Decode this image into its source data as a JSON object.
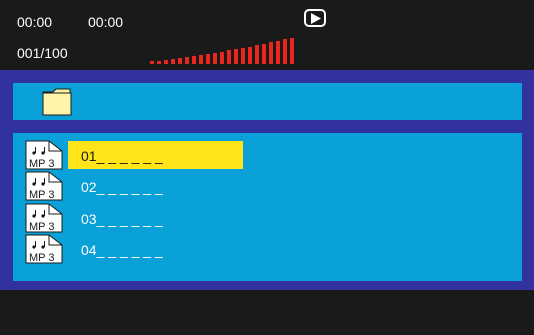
{
  "status": {
    "elapsed_time": "00:00",
    "total_time": "00:00",
    "track_counter": "001/100",
    "play_state_icon": "play-icon"
  },
  "level_meter": {
    "level": 1.0,
    "colors": {
      "bar": "#e8281e"
    }
  },
  "folder": {
    "icon": "folder-icon"
  },
  "file_list": {
    "items": [
      {
        "label": "01_ _ _ _ _ _",
        "icon": "mp3-file-icon",
        "icon_text": "MP 3",
        "selected": true
      },
      {
        "label": "02_ _ _ _ _ _",
        "icon": "mp3-file-icon",
        "icon_text": "MP 3",
        "selected": false
      },
      {
        "label": "03_ _ _ _ _ _",
        "icon": "mp3-file-icon",
        "icon_text": "MP 3",
        "selected": false
      },
      {
        "label": "04_ _ _ _ _ _",
        "icon": "mp3-file-icon",
        "icon_text": "MP 3",
        "selected": false
      }
    ]
  },
  "colors": {
    "background": "#1a1a1a",
    "panel_border": "#3131a0",
    "panel_fill": "#0aa0d8",
    "highlight": "#ffe41a",
    "text": "#ffffff"
  }
}
